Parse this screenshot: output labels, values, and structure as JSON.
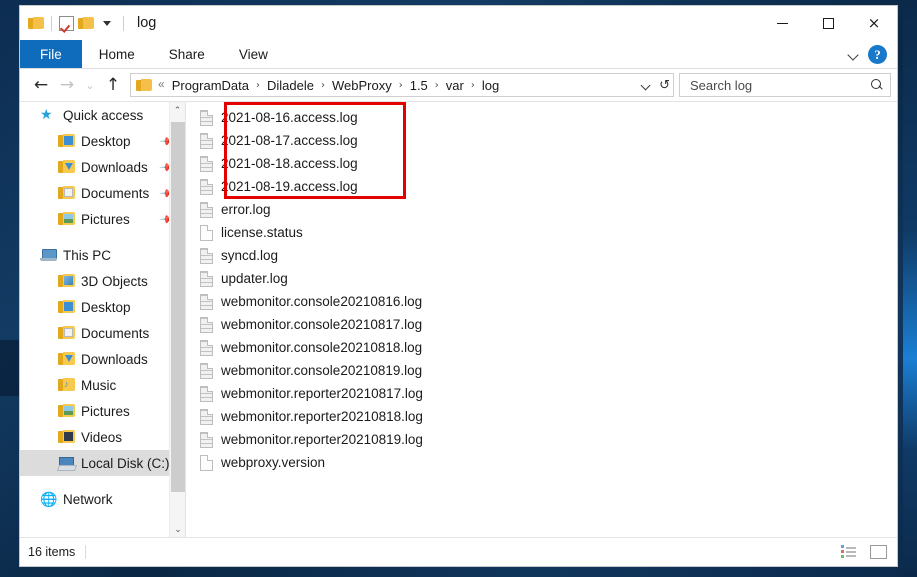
{
  "window": {
    "title": "log",
    "quick_access": [
      {
        "name": "folder-icon",
        "label": ""
      },
      {
        "name": "properties-check-icon",
        "label": ""
      },
      {
        "name": "new-folder-icon",
        "label": ""
      },
      {
        "name": "customize-toolbar-caret-icon",
        "label": ""
      }
    ],
    "controls": {
      "minimize": "—",
      "maximize": "",
      "close": "×"
    }
  },
  "ribbon": {
    "tabs": [
      {
        "label": "File",
        "active": true
      },
      {
        "label": "Home",
        "active": false
      },
      {
        "label": "Share",
        "active": false
      },
      {
        "label": "View",
        "active": false
      }
    ],
    "collapse_icon": "chevron-down-icon",
    "help_label": "?"
  },
  "address_bar": {
    "back_icon": "←",
    "forward_icon": "→",
    "recent_icon": "⌄",
    "up_icon": "↑",
    "path_separator": "›",
    "leading_dots": "«",
    "crumbs": [
      "ProgramData",
      "Diladele",
      "WebProxy",
      "1.5",
      "var",
      "log"
    ],
    "refresh_icon": "↺",
    "dropdown_icon": "chevron-down-icon"
  },
  "search": {
    "placeholder": "Search log",
    "value": "",
    "icon": "search-icon"
  },
  "sidebar": {
    "items": [
      {
        "label": "Quick access",
        "icon": "star-icon",
        "level": 0,
        "pinned": false,
        "selected": false
      },
      {
        "label": "Desktop",
        "icon": "folder-desktop-icon",
        "level": 1,
        "pinned": true,
        "selected": false
      },
      {
        "label": "Downloads",
        "icon": "folder-downloads-icon",
        "level": 1,
        "pinned": true,
        "selected": false
      },
      {
        "label": "Documents",
        "icon": "folder-documents-icon",
        "level": 1,
        "pinned": true,
        "selected": false
      },
      {
        "label": "Pictures",
        "icon": "folder-pictures-icon",
        "level": 1,
        "pinned": true,
        "selected": false
      },
      {
        "label": "This PC",
        "icon": "this-pc-icon",
        "level": 0,
        "pinned": false,
        "selected": false
      },
      {
        "label": "3D Objects",
        "icon": "folder-3d-objects-icon",
        "level": 1,
        "pinned": false,
        "selected": false
      },
      {
        "label": "Desktop",
        "icon": "folder-desktop-icon",
        "level": 1,
        "pinned": false,
        "selected": false
      },
      {
        "label": "Documents",
        "icon": "folder-documents-icon",
        "level": 1,
        "pinned": false,
        "selected": false
      },
      {
        "label": "Downloads",
        "icon": "folder-downloads-icon",
        "level": 1,
        "pinned": false,
        "selected": false
      },
      {
        "label": "Music",
        "icon": "folder-music-icon",
        "level": 1,
        "pinned": false,
        "selected": false
      },
      {
        "label": "Pictures",
        "icon": "folder-pictures-icon",
        "level": 1,
        "pinned": false,
        "selected": false
      },
      {
        "label": "Videos",
        "icon": "folder-videos-icon",
        "level": 1,
        "pinned": false,
        "selected": false
      },
      {
        "label": "Local Disk (C:)",
        "icon": "local-disk-icon",
        "level": 1,
        "pinned": false,
        "selected": true
      },
      {
        "label": "Network",
        "icon": "network-icon",
        "level": 0,
        "pinned": false,
        "selected": false
      }
    ],
    "scroll_up_icon": "⌃",
    "scroll_down_icon": "⌄"
  },
  "files": [
    {
      "name": "2021-08-16.access.log",
      "icon": "log-file-icon",
      "highlighted": true
    },
    {
      "name": "2021-08-17.access.log",
      "icon": "log-file-icon",
      "highlighted": true
    },
    {
      "name": "2021-08-18.access.log",
      "icon": "log-file-icon",
      "highlighted": true
    },
    {
      "name": "2021-08-19.access.log",
      "icon": "log-file-icon",
      "highlighted": true
    },
    {
      "name": "error.log",
      "icon": "log-file-icon",
      "highlighted": false
    },
    {
      "name": "license.status",
      "icon": "blank-file-icon",
      "highlighted": false
    },
    {
      "name": "syncd.log",
      "icon": "log-file-icon",
      "highlighted": false
    },
    {
      "name": "updater.log",
      "icon": "log-file-icon",
      "highlighted": false
    },
    {
      "name": "webmonitor.console20210816.log",
      "icon": "log-file-icon",
      "highlighted": false
    },
    {
      "name": "webmonitor.console20210817.log",
      "icon": "log-file-icon",
      "highlighted": false
    },
    {
      "name": "webmonitor.console20210818.log",
      "icon": "log-file-icon",
      "highlighted": false
    },
    {
      "name": "webmonitor.console20210819.log",
      "icon": "log-file-icon",
      "highlighted": false
    },
    {
      "name": "webmonitor.reporter20210817.log",
      "icon": "log-file-icon",
      "highlighted": false
    },
    {
      "name": "webmonitor.reporter20210818.log",
      "icon": "log-file-icon",
      "highlighted": false
    },
    {
      "name": "webmonitor.reporter20210819.log",
      "icon": "log-file-icon",
      "highlighted": false
    },
    {
      "name": "webproxy.version",
      "icon": "blank-file-icon",
      "highlighted": false
    }
  ],
  "annotation": {
    "color": "#e50000",
    "encloses": "2021-08-16.access.log through 2021-08-19.access.log"
  },
  "statusbar": {
    "item_count": "16 items",
    "view_details_icon": "details-view-icon",
    "view_tiles_icon": "large-icons-view-icon"
  },
  "colors": {
    "accent_blue": "#0f6cbd",
    "annotation_red": "#e50000",
    "folder_yellow": "#f7c94f",
    "selection_grey": "#dcdcdc"
  }
}
